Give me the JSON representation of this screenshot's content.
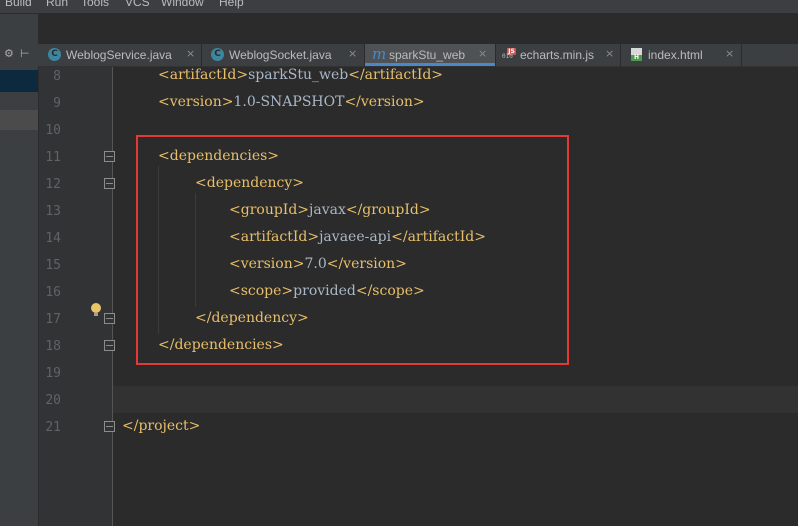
{
  "menu": [
    {
      "label": "Build",
      "mnemonic": "B"
    },
    {
      "label": "Run",
      "mnemonic": "u"
    },
    {
      "label": "Tools",
      "mnemonic": "T"
    },
    {
      "label": "VCS",
      "mnemonic": "S"
    },
    {
      "label": "Window",
      "mnemonic": "W"
    },
    {
      "label": "Help",
      "mnemonic": "H"
    }
  ],
  "tabs": [
    {
      "label": "WeblogService.java",
      "icon": "java-class-icon",
      "active": false
    },
    {
      "label": "WeblogSocket.java",
      "icon": "java-class-icon",
      "active": false
    },
    {
      "label": "sparkStu_web",
      "icon": "maven-icon",
      "active": true
    },
    {
      "label": "echarts.min.js",
      "icon": "js-file-icon",
      "active": false
    },
    {
      "label": "index.html",
      "icon": "html-file-icon",
      "active": false
    }
  ],
  "tab_close_glyph": "×",
  "line_numbers": [
    "8",
    "9",
    "10",
    "11",
    "12",
    "13",
    "14",
    "15",
    "16",
    "17",
    "18",
    "19",
    "20",
    "21"
  ],
  "code": [
    {
      "open": "<artifactId>",
      "text": "sparkStu_web",
      "close": "</artifactId>"
    },
    {
      "open": "<version>",
      "text": "1.0-SNAPSHOT",
      "close": "</version>"
    },
    {
      "open": "",
      "text": "",
      "close": ""
    },
    {
      "open": "<dependencies>",
      "text": "",
      "close": ""
    },
    {
      "open": "<dependency>",
      "text": "",
      "close": ""
    },
    {
      "open": "<groupId>",
      "text": "javax",
      "close": "</groupId>"
    },
    {
      "open": "<artifactId>",
      "text": "javaee-api",
      "close": "</artifactId>"
    },
    {
      "open": "<version>",
      "text": "7.0",
      "close": "</version>"
    },
    {
      "open": "<scope>",
      "text": "provided",
      "close": "</scope>"
    },
    {
      "open": "</dependency>",
      "text": "",
      "close": ""
    },
    {
      "open": "</dependencies>",
      "text": "",
      "close": ""
    },
    {
      "open": "",
      "text": "",
      "close": ""
    },
    {
      "open": "",
      "text": "",
      "close": ""
    },
    {
      "open": "</project>",
      "text": "",
      "close": ""
    }
  ],
  "colors": {
    "background": "#2b2b2b",
    "tag": "#e8bf6a",
    "text": "#a9b7c6",
    "line_number": "#606366",
    "highlight_box": "#e53935",
    "active_tab_underline": "#4a88c7"
  }
}
